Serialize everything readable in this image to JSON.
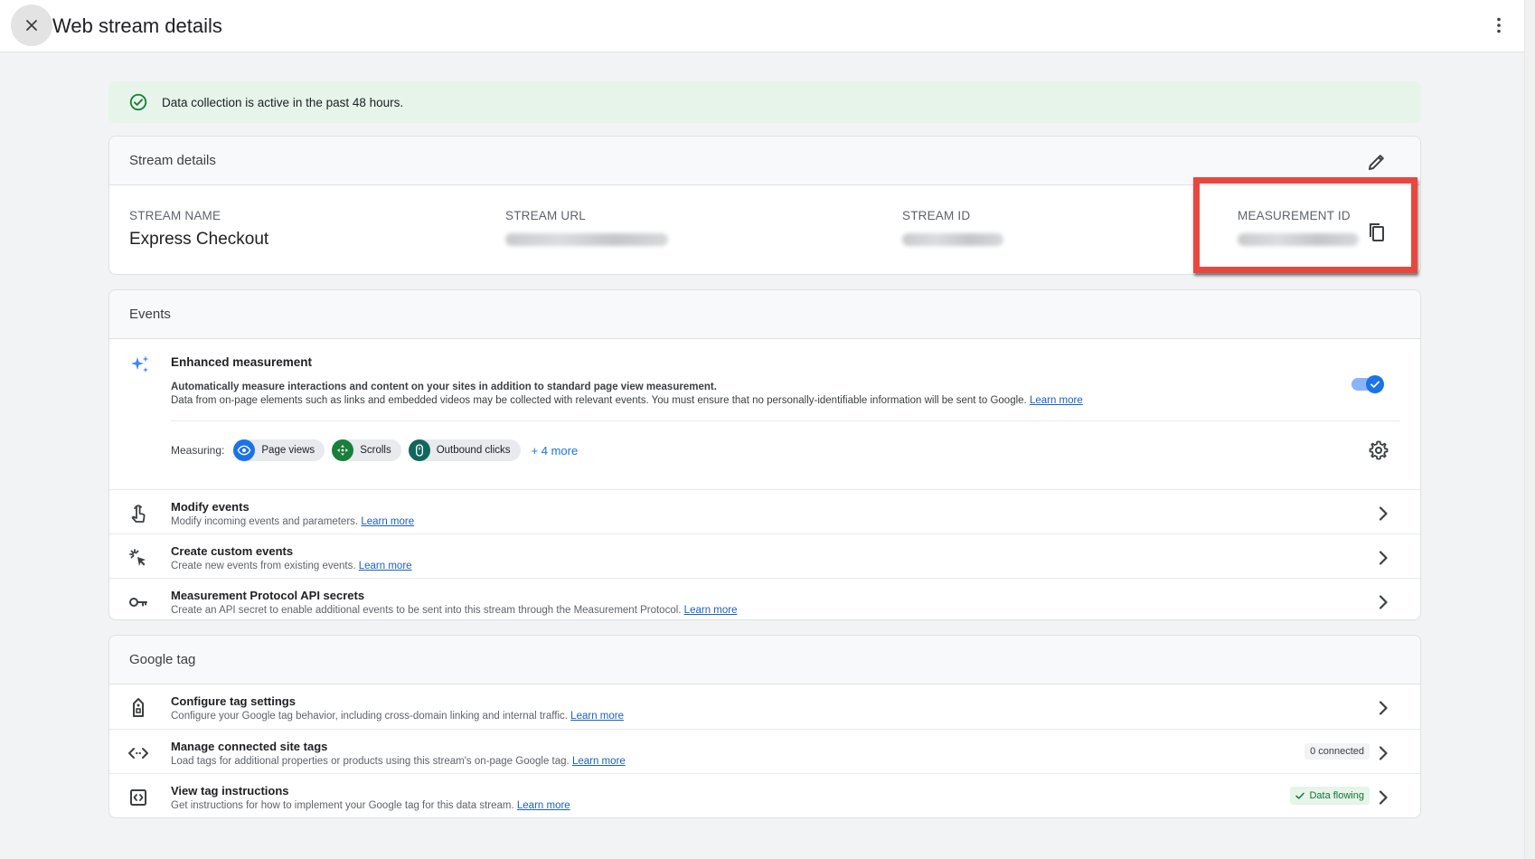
{
  "header": {
    "title": "Web stream details",
    "close_icon": "close-icon",
    "more_icon": "more-vert-icon"
  },
  "banner": {
    "text": "Data collection is active in the past 48 hours.",
    "icon": "check-circle-icon",
    "color": "#e6f4ea"
  },
  "stream_details": {
    "header": "Stream details",
    "fields": [
      {
        "label": "STREAM NAME",
        "value": "Express Checkout"
      },
      {
        "label": "STREAM URL"
      },
      {
        "label": "STREAM ID"
      },
      {
        "label": "MEASUREMENT ID"
      }
    ],
    "highlight_color": "#e8473f"
  },
  "events": {
    "header": "Events",
    "enhanced": {
      "title": "Enhanced measurement",
      "desc1": "Automatically measure interactions and content on your sites in addition to standard page view measurement.",
      "desc2": "Data from on-page elements such as links and embedded videos may be collected with relevant events. You must ensure that no personally-identifiable information will be sent to Google.",
      "learn_more": "Learn more",
      "toggle_on": true,
      "measuring_label": "Measuring:",
      "chips": [
        {
          "label": "Page views",
          "icon": "eye-icon",
          "color": "#1a73e8"
        },
        {
          "label": "Scrolls",
          "icon": "scroll-icon",
          "color": "#188038"
        },
        {
          "label": "Outbound clicks",
          "icon": "mouse-icon",
          "color": "#12675c"
        }
      ],
      "more": "+ 4 more"
    },
    "rows": [
      {
        "title": "Modify events",
        "desc": "Modify incoming events and parameters.",
        "learn_more": "Learn more",
        "icon": "touch-icon"
      },
      {
        "title": "Create custom events",
        "desc": "Create new events from existing events.",
        "learn_more": "Learn more",
        "icon": "sparkle-click-icon"
      },
      {
        "title": "Measurement Protocol API secrets",
        "desc": "Create an API secret to enable additional events to be sent into this stream through the Measurement Protocol.",
        "learn_more": "Learn more",
        "icon": "key-icon"
      }
    ]
  },
  "google_tag": {
    "header": "Google tag",
    "rows": [
      {
        "title": "Configure tag settings",
        "desc": "Configure your Google tag behavior, including cross-domain linking and internal traffic.",
        "learn_more": "Learn more",
        "icon": "tag-icon"
      },
      {
        "title": "Manage connected site tags",
        "desc": "Load tags for additional properties or products using this stream's on-page Google tag.",
        "learn_more": "Learn more",
        "icon": "code-icon",
        "badge": "0 connected"
      },
      {
        "title": "View tag instructions",
        "desc": "Get instructions for how to implement your Google tag for this data stream.",
        "learn_more": "Learn more",
        "icon": "tag-instructions-icon",
        "badge": "Data flowing"
      }
    ]
  },
  "accent": "#1a73e8"
}
